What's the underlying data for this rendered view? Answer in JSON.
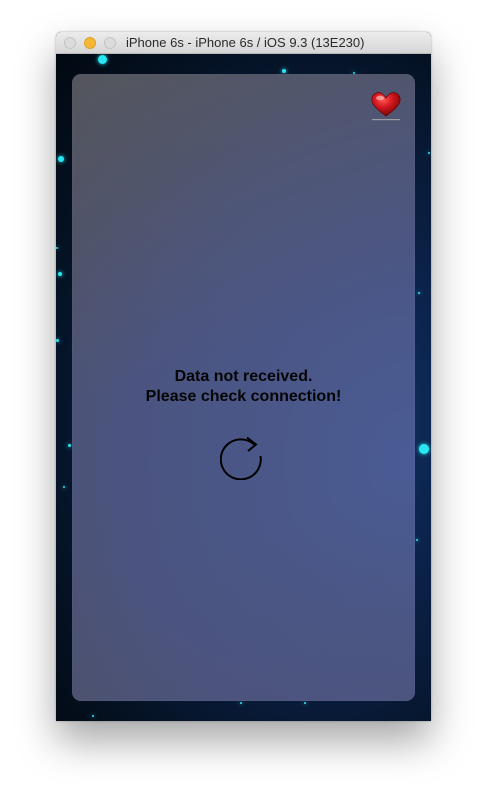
{
  "window": {
    "title": "iPhone 6s - iPhone 6s / iOS 9.3 (13E230)",
    "controls": [
      "close",
      "minimize",
      "zoom"
    ]
  },
  "app": {
    "favorite_icon": "heart-icon",
    "error_line1": "Data not received.",
    "error_line2": "Please check connection!",
    "reload_icon": "refresh-icon"
  },
  "colors": {
    "star": "#28e6f2",
    "heart": "#c8121a",
    "text": "#050505"
  }
}
